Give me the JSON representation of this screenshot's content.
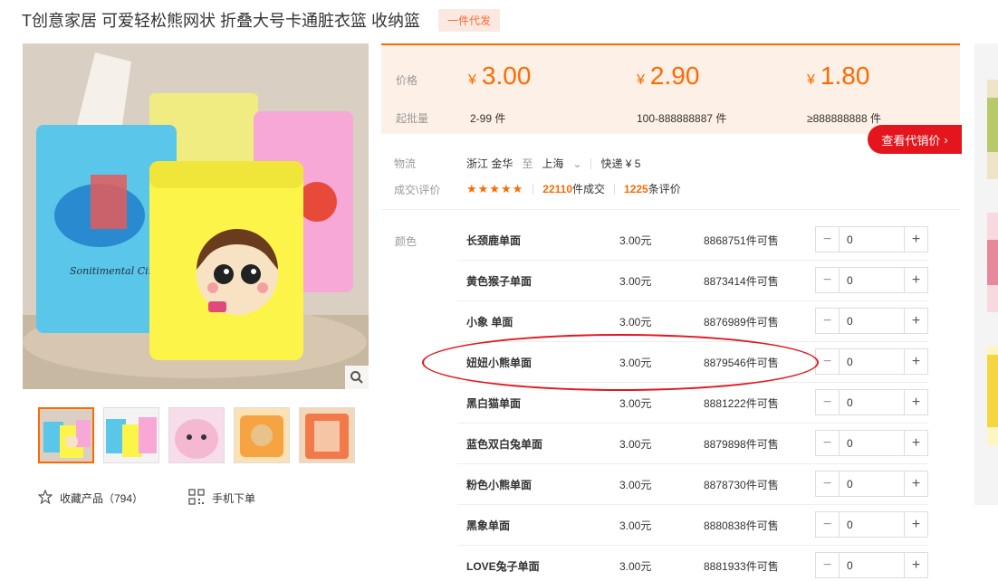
{
  "product": {
    "title": "T创意家居 可爱轻松熊网状 折叠大号卡通脏衣篮 收纳篮",
    "tag": "一件代发",
    "favorite_label": "收藏产品（794）",
    "mobile_label": "手机下单"
  },
  "pricing": {
    "price_label": "价格",
    "moq_label": "起批量",
    "currency": "¥",
    "tiers": [
      {
        "price": "3.00",
        "qty": "2-99 件"
      },
      {
        "price": "2.90",
        "qty": "100-888888887 件"
      },
      {
        "price": "1.80",
        "qty": "≥888888888 件"
      }
    ],
    "agent_button": "查看代销价"
  },
  "logistics": {
    "label": "物流",
    "from": "浙江 金华",
    "to_word": "至",
    "to": "上海",
    "shipping": "快递 ¥ 5"
  },
  "deals": {
    "label": "成交\\评价",
    "stars": "★★★★★",
    "sold_count": "22110",
    "sold_suffix": "件成交",
    "review_count": "1225",
    "review_suffix": "条评价"
  },
  "colors": {
    "label": "颜色",
    "items": [
      {
        "name": "长颈鹿单面",
        "price": "3.00元",
        "stock": "8868751件可售",
        "qty": "0"
      },
      {
        "name": "黄色猴子单面",
        "price": "3.00元",
        "stock": "8873414件可售",
        "qty": "0"
      },
      {
        "name": "小象 单面",
        "price": "3.00元",
        "stock": "8876989件可售",
        "qty": "0"
      },
      {
        "name": "妞妞小熊单面",
        "price": "3.00元",
        "stock": "8879546件可售",
        "qty": "0"
      },
      {
        "name": "黑白猫单面",
        "price": "3.00元",
        "stock": "8881222件可售",
        "qty": "0"
      },
      {
        "name": "蓝色双白兔单面",
        "price": "3.00元",
        "stock": "8879898件可售",
        "qty": "0"
      },
      {
        "name": "粉色小熊单面",
        "price": "3.00元",
        "stock": "8878730件可售",
        "qty": "0"
      },
      {
        "name": "黑象单面",
        "price": "3.00元",
        "stock": "8880838件可售",
        "qty": "0"
      },
      {
        "name": "LOVE兔子单面",
        "price": "3.00元",
        "stock": "8881933件可售",
        "qty": "0"
      }
    ]
  },
  "image_text": {
    "elephant_caption": "Sonitimental Circus."
  },
  "theme": {
    "accent": "#ff6a00",
    "cta": "#e4151d",
    "panel_bg": "#fdf0e6"
  }
}
